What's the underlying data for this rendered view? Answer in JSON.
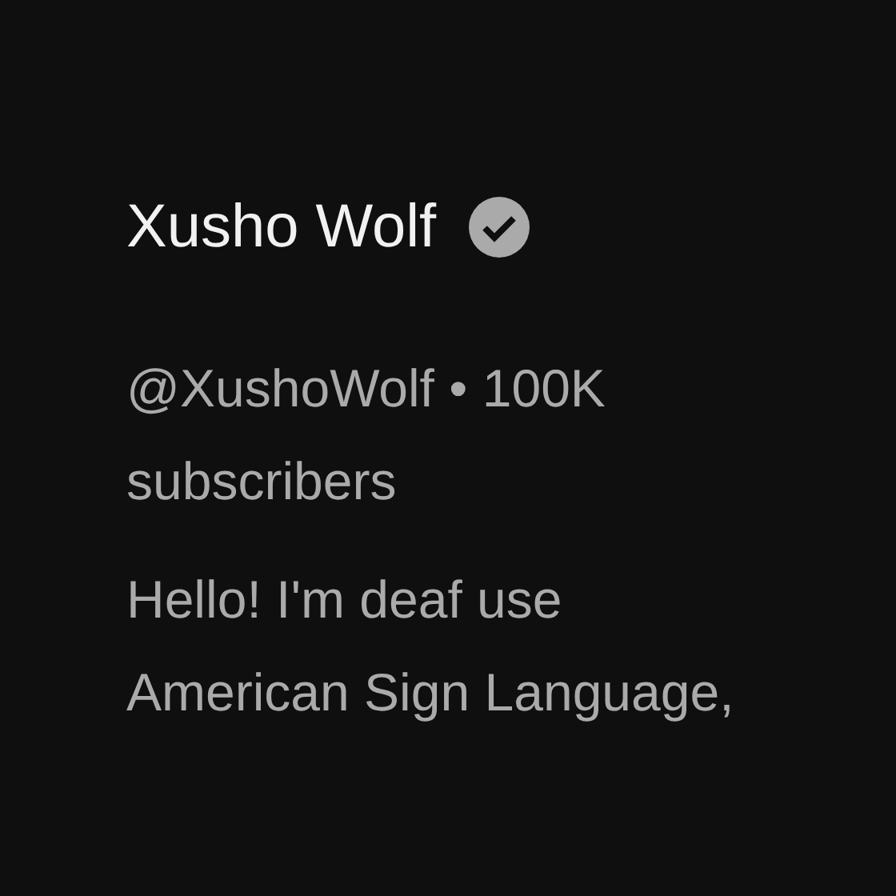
{
  "channel": {
    "name": "Xusho Wolf",
    "verified": true,
    "handle": "@XushoWolf",
    "separator": "•",
    "subscribers": "100K subscribers",
    "description": "Hello! I'm deaf use American Sign Language,"
  }
}
